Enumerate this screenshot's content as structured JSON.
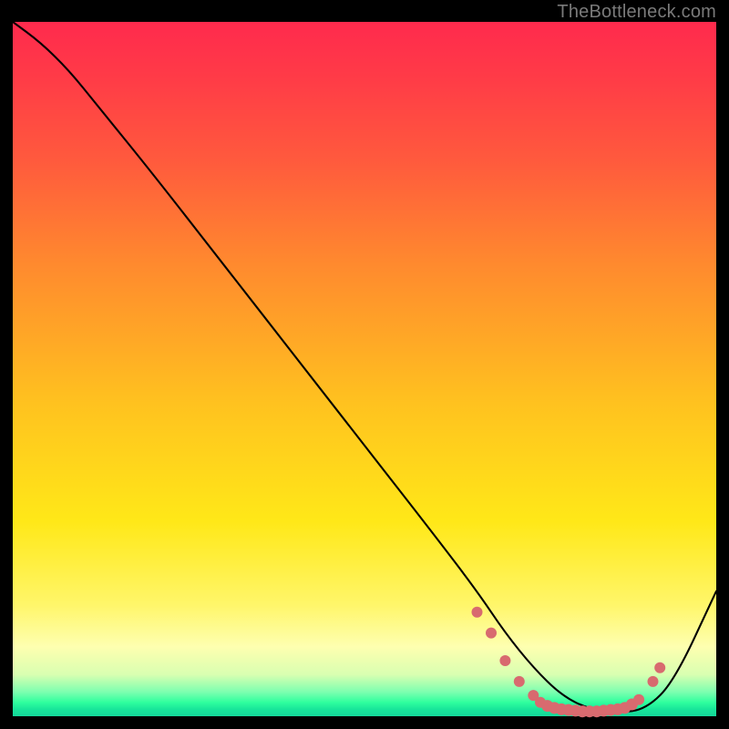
{
  "watermark": "TheBottleneck.com",
  "colors": {
    "dot": "#d86a6f",
    "curve": "#000000"
  },
  "chart_data": {
    "type": "line",
    "title": "",
    "xlabel": "",
    "ylabel": "",
    "xlim": [
      0,
      100
    ],
    "ylim": [
      0,
      100
    ],
    "grid": false,
    "legend": false,
    "series": [
      {
        "name": "curve",
        "x": [
          0,
          4,
          8,
          12,
          20,
          30,
          40,
          50,
          60,
          66,
          70,
          74,
          78,
          82,
          86,
          90,
          94,
          100
        ],
        "y": [
          100,
          97,
          93,
          88,
          78,
          65,
          52,
          39,
          26,
          18,
          12,
          7,
          3,
          1,
          0.5,
          1,
          5,
          18
        ]
      }
    ],
    "markers": [
      {
        "x": 66,
        "y": 15
      },
      {
        "x": 68,
        "y": 12
      },
      {
        "x": 70,
        "y": 8
      },
      {
        "x": 72,
        "y": 5
      },
      {
        "x": 74,
        "y": 3
      },
      {
        "x": 75,
        "y": 2
      },
      {
        "x": 76,
        "y": 1.5
      },
      {
        "x": 77,
        "y": 1.2
      },
      {
        "x": 78,
        "y": 1
      },
      {
        "x": 79,
        "y": 0.9
      },
      {
        "x": 80,
        "y": 0.8
      },
      {
        "x": 81,
        "y": 0.7
      },
      {
        "x": 82,
        "y": 0.7
      },
      {
        "x": 83,
        "y": 0.7
      },
      {
        "x": 84,
        "y": 0.8
      },
      {
        "x": 85,
        "y": 0.9
      },
      {
        "x": 86,
        "y": 1
      },
      {
        "x": 87,
        "y": 1.2
      },
      {
        "x": 88,
        "y": 1.7
      },
      {
        "x": 89,
        "y": 2.4
      },
      {
        "x": 91,
        "y": 5
      },
      {
        "x": 92,
        "y": 7
      }
    ]
  }
}
